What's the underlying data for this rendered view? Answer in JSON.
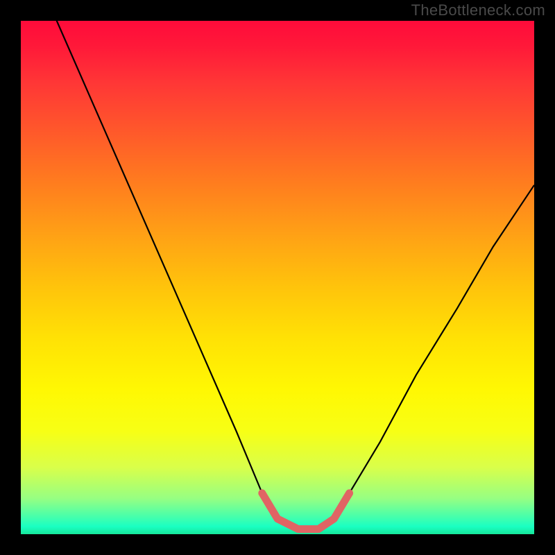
{
  "watermark": "TheBottleneck.com",
  "chart_data": {
    "type": "line",
    "title": "",
    "xlabel": "",
    "ylabel": "",
    "xlim": [
      0,
      100
    ],
    "ylim": [
      0,
      100
    ],
    "series": [
      {
        "name": "main-curve",
        "color": "#000000",
        "x": [
          0,
          7,
          14,
          21,
          28,
          35,
          42,
          47,
          50,
          54,
          58,
          61,
          64,
          70,
          77,
          85,
          92,
          100
        ],
        "y": [
          115,
          100,
          84,
          68,
          52,
          36,
          20,
          8,
          3,
          1,
          1,
          3,
          8,
          18,
          31,
          44,
          56,
          68
        ]
      },
      {
        "name": "highlight-band",
        "color": "#e06464",
        "x": [
          47,
          50,
          54,
          58,
          61,
          64
        ],
        "y": [
          8,
          3,
          1,
          1,
          3,
          8
        ]
      }
    ],
    "gradient_background": {
      "direction": "vertical",
      "stops": [
        {
          "pos": 0.0,
          "color": "#ff0b3a"
        },
        {
          "pos": 0.5,
          "color": "#ffd400"
        },
        {
          "pos": 0.85,
          "color": "#f7ff15"
        },
        {
          "pos": 1.0,
          "color": "#16e79a"
        }
      ]
    }
  }
}
